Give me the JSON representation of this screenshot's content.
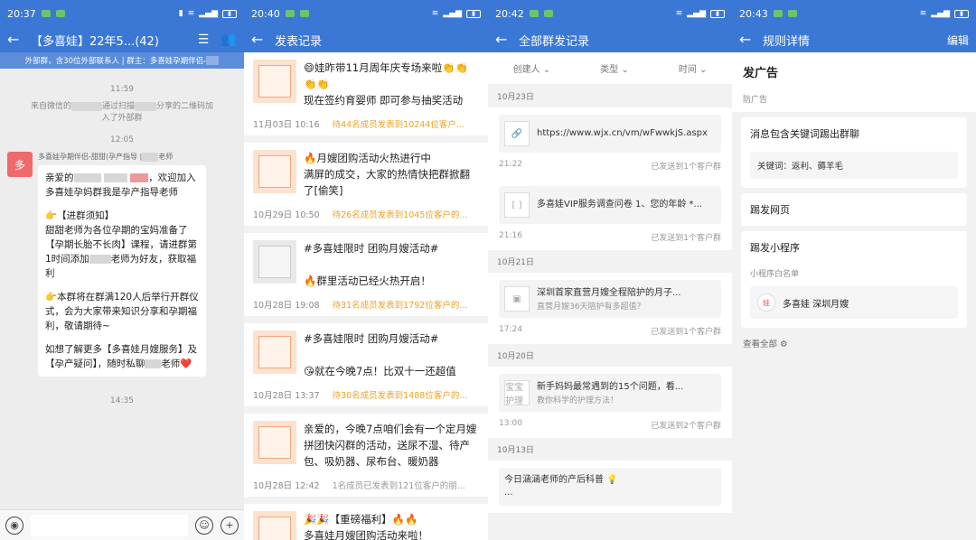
{
  "screen1": {
    "status_time": "20:37",
    "back": "←",
    "title": "【多喜娃】22年5...(42)",
    "subbar": "外部群，含30位外部联系人 | 群主：多喜娃孕期伴侣-",
    "time1": "11:59",
    "sys_a": "来自微信的",
    "sys_b": "通过扫描",
    "sys_c": "分享的二维码加入了外部群",
    "time2": "12:05",
    "sender": "多喜娃孕期伴侣-甜甜(孕产指导 |",
    "sender_tail": "老师",
    "avatar": "多",
    "b1a": "亲爱的",
    "b1b": "，欢迎加入多喜娃孕妈群我是孕产指导老师",
    "b2": "👉【进群须知】",
    "b3": "甜甜老师为各位孕期的宝妈准备了【孕期长胎不长肉】课程，请进群第1时间添加",
    "b3b": "老师为好友，获取福利",
    "b4": "👉本群将在群满120人后举行开群仪式，会为大家带来知识分享和孕期福利，敬请期待~",
    "b5a": "如想了解更多【多喜娃月嫂服务】及【孕产疑问】，随时私聊",
    "b5b": "老师❤️",
    "time3": "14:35"
  },
  "screen2": {
    "status_time": "20:40",
    "title": "发表记录",
    "posts": [
      {
        "text": "😄娃昨带11月周年庆专场来啦👏👏👏👏\n现在签约育婴师 即可参与抽奖活动",
        "date": "11月03日 10:16",
        "stat": "待44名成员发表到10244位客户..."
      },
      {
        "text": "🔥月嫂团购活动火热进行中\n满屏的成交，大家的热情快把群掀翻了[偷笑]",
        "date": "10月29日 10:50",
        "stat": "待26名成员发表到1045位客户的..."
      },
      {
        "text": "#多喜娃限时 团购月嫂活动#\n\n🔥群里活动已经火热开启！",
        "date": "10月28日 19:08",
        "stat": "待31名成员发表到1792位客户的..."
      },
      {
        "text": "#多喜娃限时 团购月嫂活动#\n\n😘就在今晚7点！比双十一还超值",
        "date": "10月28日 13:37",
        "stat": "待30名成员发表到1488位客户的..."
      },
      {
        "text": "亲爱的，今晚7点咱们会有一个定月嫂拼团快闪群的活动，送尿不湿、待产包、吸奶器、尿布台、暖奶器",
        "date": "10月28日 12:42",
        "stat": "1名成员已发表到121位客户的朋..."
      },
      {
        "text": "🎉🎉【重磅福利】🔥🔥\n多喜娃月嫂团购活动来啦！",
        "date": "",
        "stat": ""
      }
    ]
  },
  "screen3": {
    "status_time": "20:42",
    "title": "全部群发记录",
    "filters": [
      "创建人 ⌄",
      "类型 ⌄",
      "时间 ⌄"
    ],
    "groups": [
      {
        "date": "10月23日",
        "items": [
          {
            "icon": "🔗",
            "text": "https://www.wjx.cn/vm/wFwwkjS.aspx",
            "sub": "",
            "time": "21:22",
            "sent": "已发送到1个客户群"
          },
          {
            "icon": "[ ]",
            "text": "多喜娃VIP服务调查问卷 1、您的年龄 *...",
            "sub": "",
            "time": "21:16",
            "sent": "已发送到1个客户群"
          }
        ]
      },
      {
        "date": "10月21日",
        "items": [
          {
            "icon": "▣",
            "text": "深圳首家直营月嫂全程陪护的月子...",
            "sub": "直营月嫂36天陪护有多超值？",
            "time": "17:24",
            "sent": "已发送到1个客户群"
          }
        ]
      },
      {
        "date": "10月20日",
        "items": [
          {
            "icon": "宝宝护理",
            "text": "新手妈妈最常遇到的15个问题，看...",
            "sub": "教你科学的护理方法！",
            "time": "13:00",
            "sent": "已发送到2个客户群"
          }
        ]
      },
      {
        "date": "10月13日",
        "items": [
          {
            "icon": "",
            "text": "今日涵涵老师的产后科普 💡\n...",
            "sub": "",
            "time": "",
            "sent": ""
          }
        ]
      }
    ]
  },
  "screen4": {
    "status_time": "20:43",
    "title": "规则详情",
    "edit": "编辑",
    "heading": "发广告",
    "sub": "防广告",
    "rule1": "消息包含关键词踢出群聊",
    "keywords": "关键词：返利、薅羊毛",
    "rule2": "踢发网页",
    "rule3": "踢发小程序",
    "mp_label": "小程序白名单",
    "mp_logo": "娃",
    "mp_name": "多喜娃 深圳月嫂",
    "view_all": "查看全部 ⚙"
  }
}
